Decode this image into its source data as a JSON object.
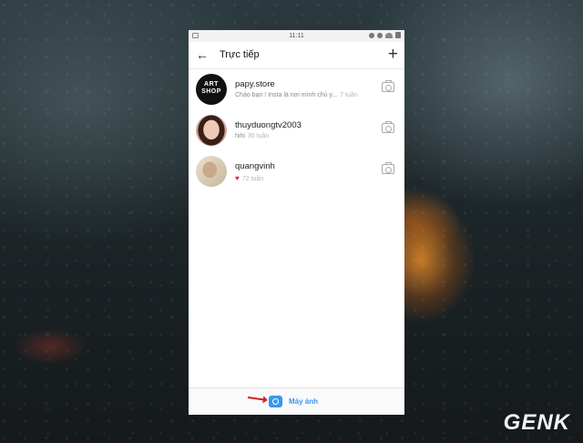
{
  "status_bar": {
    "time": "11:11"
  },
  "header": {
    "title": "Trực tiếp",
    "back_icon": "arrow-left-icon",
    "new_icon": "plus-icon"
  },
  "conversations": [
    {
      "username": "papy.store",
      "preview": "Chào bạn ! Insta là nơi mình chủ y...",
      "ago": "7 tuần",
      "avatar_text": "ART SHOP",
      "heart": false
    },
    {
      "username": "thuyduongtv2003",
      "preview": "hihi",
      "ago": "30 tuần",
      "avatar_text": "",
      "heart": false
    },
    {
      "username": "quangvinh",
      "preview": "",
      "ago": "72 tuần",
      "avatar_text": "",
      "heart": true
    }
  ],
  "bottom_bar": {
    "camera_label": "Máy ảnh",
    "camera_icon": "camera-icon"
  },
  "watermark": {
    "text": "GENK"
  },
  "colors": {
    "accent": "#3897f0",
    "heart": "#e0244c",
    "arrow": "#d81e1e"
  }
}
